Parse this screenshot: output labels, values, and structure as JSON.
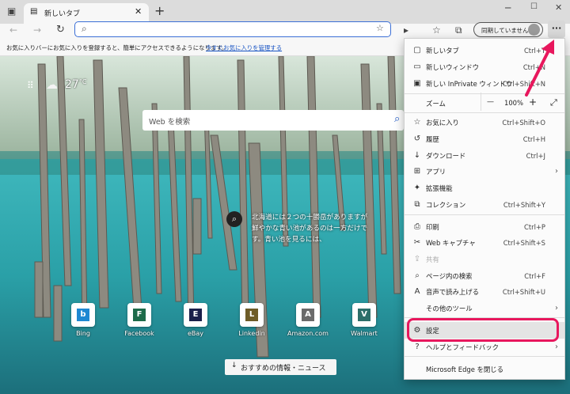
{
  "tab": {
    "title": "新しいタブ",
    "new_tab_symbol": "+"
  },
  "window_controls": {
    "minimize": "─",
    "maximize": "☐",
    "close": "✕"
  },
  "toolbar": {
    "back": "←",
    "forward": "→",
    "refresh": "↻",
    "address_value": "",
    "profile_label": "同期していません",
    "more_label": "···"
  },
  "favbar": {
    "message": "お気に入りバーにお気に入りを登録すると、簡単にアクセスできるようになります。",
    "link": "今すぐお気に入りを管理する"
  },
  "newtab": {
    "weather_temp": "27",
    "weather_unit": "°C",
    "search_placeholder": "Web を検索",
    "caption_line1": "北海道には２つの十勝岳がありますが",
    "caption_line2": "鮮やかな青い池があるのは一方だけで",
    "caption_line3": "す。青い池を見るには、",
    "tiles": [
      {
        "label": "Bing",
        "letter": "b",
        "color": "#1e88d2"
      },
      {
        "label": "Facebook",
        "letter": "F",
        "color": "#1d6b4a"
      },
      {
        "label": "eBay",
        "letter": "E",
        "color": "#1a1f4a"
      },
      {
        "label": "Linkedin",
        "letter": "L",
        "color": "#6e5c28"
      },
      {
        "label": "Amazon.com",
        "letter": "A",
        "color": "#6b6b6b"
      },
      {
        "label": "Walmart",
        "letter": "V",
        "color": "#2d6e6a"
      }
    ],
    "news_button": "おすすめの情報・ニュース"
  },
  "menu": {
    "items": [
      {
        "label": "新しいタブ",
        "shortcut": "Ctrl+T",
        "icon": "new-tab-icon",
        "glyph": "▢"
      },
      {
        "label": "新しいウィンドウ",
        "shortcut": "Ctrl+N",
        "icon": "new-window-icon",
        "glyph": "▭"
      },
      {
        "label": "新しい InPrivate ウィンドウ",
        "shortcut": "Ctrl+Shift+N",
        "icon": "inprivate-icon",
        "glyph": "▣"
      },
      {
        "label": "お気に入り",
        "shortcut": "Ctrl+Shift+O",
        "icon": "favorites-icon",
        "glyph": "☆"
      },
      {
        "label": "履歴",
        "shortcut": "Ctrl+H",
        "icon": "history-icon",
        "glyph": "↺"
      },
      {
        "label": "ダウンロード",
        "shortcut": "Ctrl+J",
        "icon": "download-icon",
        "glyph": "↓"
      },
      {
        "label": "アプリ",
        "shortcut": "",
        "icon": "apps-icon",
        "glyph": "⊞",
        "arrow": true
      },
      {
        "label": "拡張機能",
        "shortcut": "",
        "icon": "extensions-icon",
        "glyph": "✦"
      },
      {
        "label": "コレクション",
        "shortcut": "Ctrl+Shift+Y",
        "icon": "collections-icon",
        "glyph": "⧉"
      },
      {
        "label": "印刷",
        "shortcut": "Ctrl+P",
        "icon": "print-icon",
        "glyph": "⎙"
      },
      {
        "label": "Web キャプチャ",
        "shortcut": "Ctrl+Shift+S",
        "icon": "web-capture-icon",
        "glyph": "✂"
      },
      {
        "label": "共有",
        "shortcut": "",
        "icon": "share-icon",
        "glyph": "⇪",
        "disabled": true
      },
      {
        "label": "ページ内の検索",
        "shortcut": "Ctrl+F",
        "icon": "find-icon",
        "glyph": "⌕"
      },
      {
        "label": "音声で読み上げる",
        "shortcut": "Ctrl+Shift+U",
        "icon": "read-aloud-icon",
        "glyph": "A"
      },
      {
        "label": "その他のツール",
        "shortcut": "",
        "icon": "more-tools-icon",
        "glyph": "",
        "arrow": true
      },
      {
        "label": "設定",
        "shortcut": "",
        "icon": "settings-icon",
        "glyph": "⚙"
      },
      {
        "label": "ヘルプとフィードバック",
        "shortcut": "",
        "icon": "help-icon",
        "glyph": "?",
        "arrow": true
      },
      {
        "label": "Microsoft Edge を閉じる",
        "shortcut": "",
        "icon": "close-edge-icon",
        "glyph": ""
      }
    ],
    "zoom": {
      "label": "ズーム",
      "minus": "—",
      "value": "100%",
      "plus": "+",
      "fullscreen": "⤢"
    }
  },
  "colors": {
    "highlight": "#e8175d",
    "address_border": "#3b6fd6"
  }
}
